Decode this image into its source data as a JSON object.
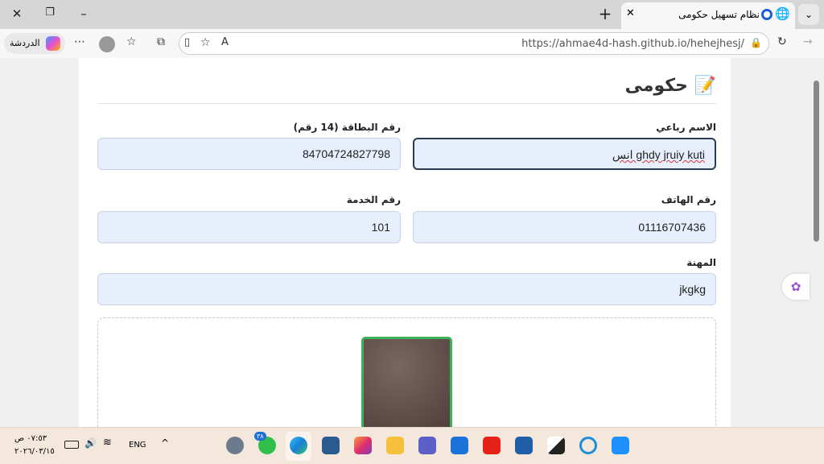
{
  "browser": {
    "tab_title": "نظام تسهيل حكومى",
    "url": "https://ahmae4d-hash.github.io/hehejhesj/",
    "chat_label": "الدردشة"
  },
  "page": {
    "title": "حكومى",
    "title_icon": "📝",
    "fields": {
      "full_name": {
        "label": "الاسم رباعي",
        "value": "ghdy jruiy kuti انس"
      },
      "card_number": {
        "label": "رقم البطاقة (14 رقم)",
        "value": "84704724827798"
      },
      "phone": {
        "label": "رقم الهاتف",
        "value": "01116707436"
      },
      "service_number": {
        "label": "رقم الخدمة",
        "value": "101"
      },
      "job": {
        "label": "المهنة",
        "value": "jkgkg"
      }
    }
  },
  "taskbar": {
    "time": "٠٧:٥٣ ص",
    "date": "٢٠٢٦/٠٣/١٥",
    "lang": "ENG",
    "whatsapp_badge": "٣٨"
  }
}
